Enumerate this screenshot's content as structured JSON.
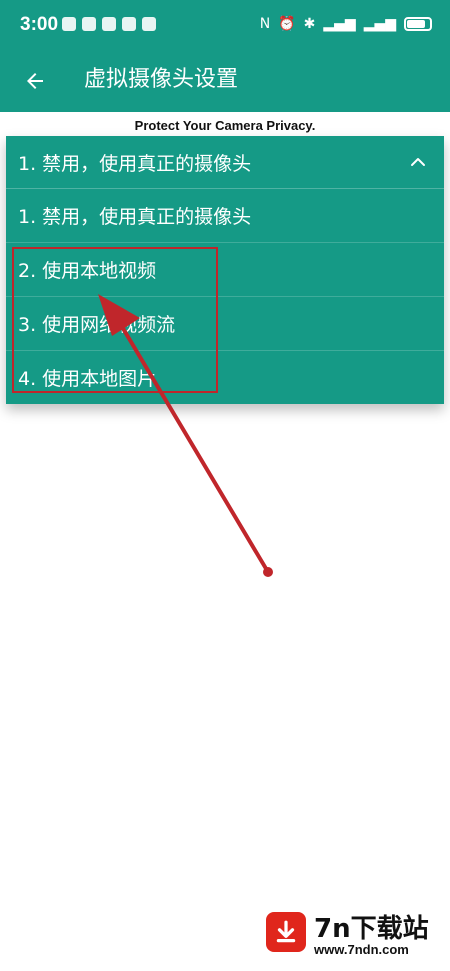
{
  "status_bar": {
    "time": "3:00"
  },
  "app_bar": {
    "title": "虚拟摄像头设置"
  },
  "privacy_text": "Protect Your Camera Privacy.",
  "dropdown": {
    "selected": "1. 禁用，使用真正的摄像头",
    "options": [
      "1. 禁用，使用真正的摄像头",
      "2. 使用本地视频",
      "3. 使用网络视频流",
      "4. 使用本地图片"
    ]
  },
  "watermark": {
    "brand": "7n下载站",
    "url": "www.7ndn.com"
  },
  "colors": {
    "accent": "#159a86",
    "annotation": "#c0262b"
  }
}
